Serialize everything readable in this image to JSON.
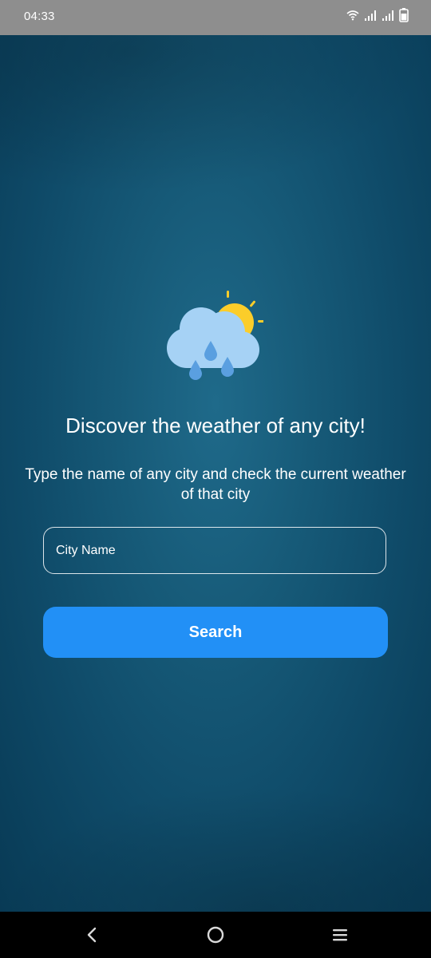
{
  "status_bar": {
    "time": "04:33",
    "icons": [
      "wifi-icon",
      "signal-icon",
      "signal-icon",
      "battery-icon"
    ]
  },
  "main": {
    "headline": "Discover the weather of any city!",
    "subtext": "Type the name of any city and check the current weather of that city",
    "city_input": {
      "placeholder": "City Name",
      "value": ""
    },
    "search_button": "Search",
    "illustration": "cloud-sun-rain-icon"
  },
  "navigation": {
    "buttons": [
      "back-icon",
      "home-icon",
      "recents-icon"
    ]
  },
  "colors": {
    "background": "#155a78",
    "status_bar": "#8e8e8e",
    "button": "#2290f6",
    "sun": "#fbcd2a",
    "cloud": "#a6d2f5",
    "raindrop": "#5a9fe0"
  }
}
